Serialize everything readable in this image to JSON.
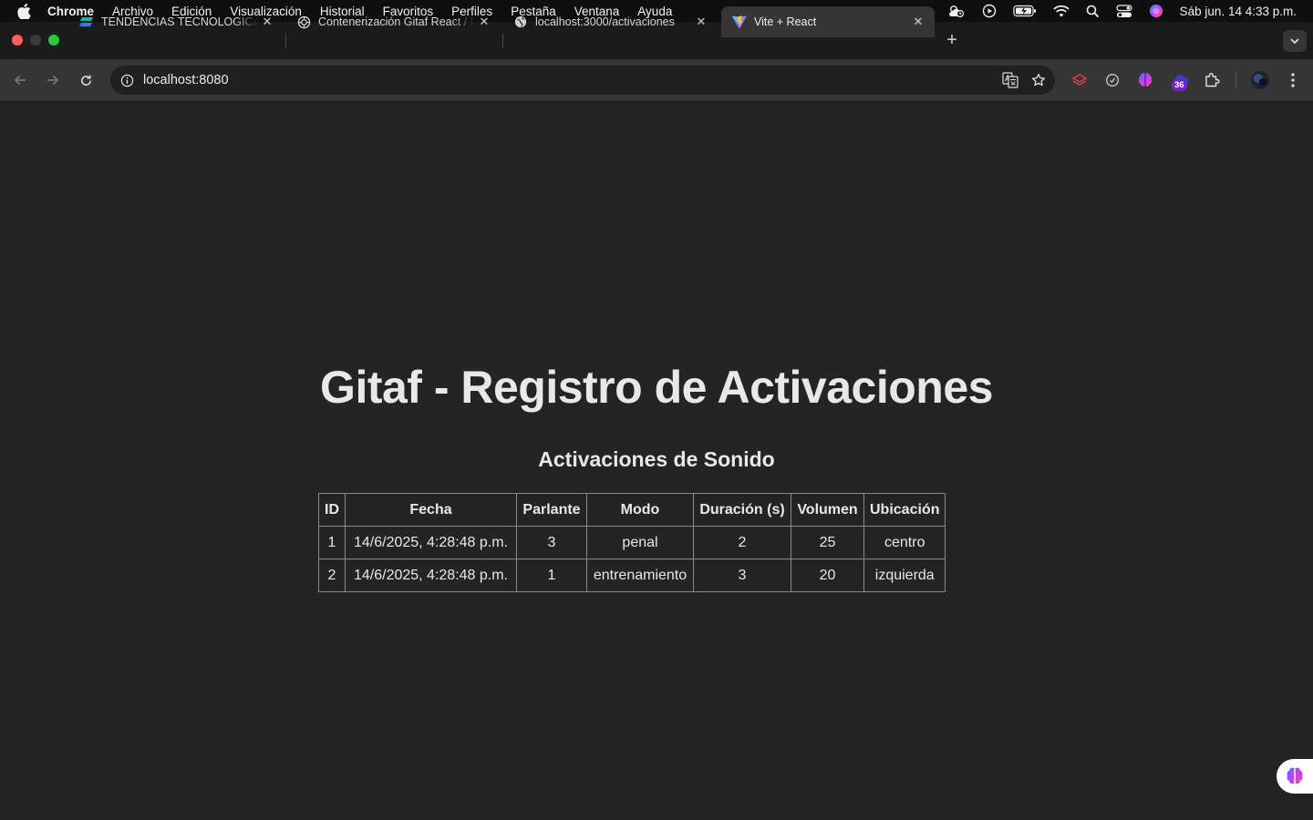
{
  "menubar": {
    "app_name": "Chrome",
    "items": [
      "Archivo",
      "Edición",
      "Visualización",
      "Historial",
      "Favoritos",
      "Perfiles",
      "Pestaña",
      "Ventana",
      "Ayuda"
    ],
    "clock": "Sáb jun. 14  4:33 p.m."
  },
  "tabs": [
    {
      "title": "TENDENCIAS TECNOLOGICAS",
      "icon": "tendencias-favicon",
      "active": false
    },
    {
      "title": "Contenerización Gitaf React / Node",
      "icon": "chatgpt-icon",
      "active": false
    },
    {
      "title": "localhost:3000/activaciones",
      "icon": "globe-icon",
      "active": false
    },
    {
      "title": "Vite + React",
      "icon": "vite-icon",
      "active": true
    }
  ],
  "toolbar": {
    "url": "localhost:8080",
    "extension_badge": "36"
  },
  "page": {
    "title": "Gitaf - Registro de Activaciones",
    "section_title": "Activaciones de Sonido",
    "table": {
      "headers": [
        "ID",
        "Fecha",
        "Parlante",
        "Modo",
        "Duración (s)",
        "Volumen",
        "Ubicación"
      ],
      "rows": [
        [
          "1",
          "14/6/2025, 4:28:48 p.m.",
          "3",
          "penal",
          "2",
          "25",
          "centro"
        ],
        [
          "2",
          "14/6/2025, 4:28:48 p.m.",
          "1",
          "entrenamiento",
          "3",
          "20",
          "izquierda"
        ]
      ]
    }
  },
  "colors": {
    "page_background": "#242424",
    "text": "#e8e8e8",
    "table_border": "#8a8a8a",
    "toolbar": "#363636",
    "tabstrip": "#1b1b1b"
  }
}
